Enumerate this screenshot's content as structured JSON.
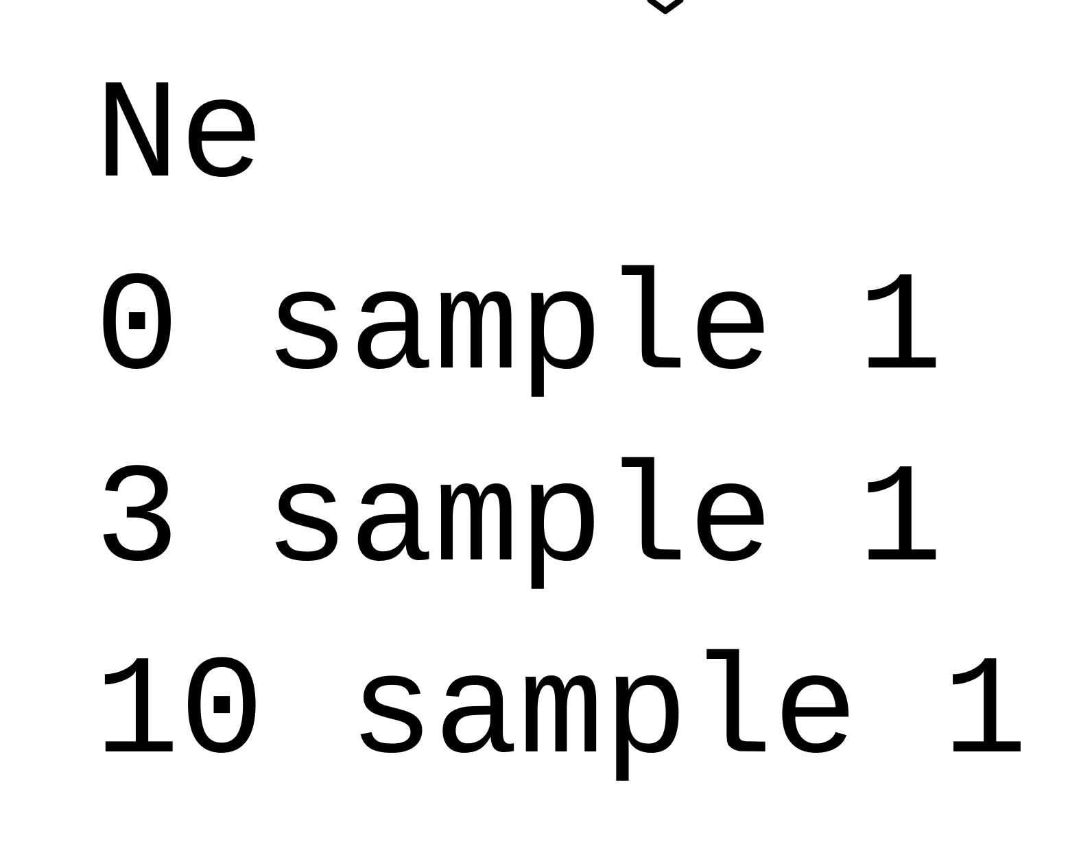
{
  "lines": [
    "Ne",
    "0 sample 1",
    "3 sample 1",
    "10 sample 1"
  ]
}
